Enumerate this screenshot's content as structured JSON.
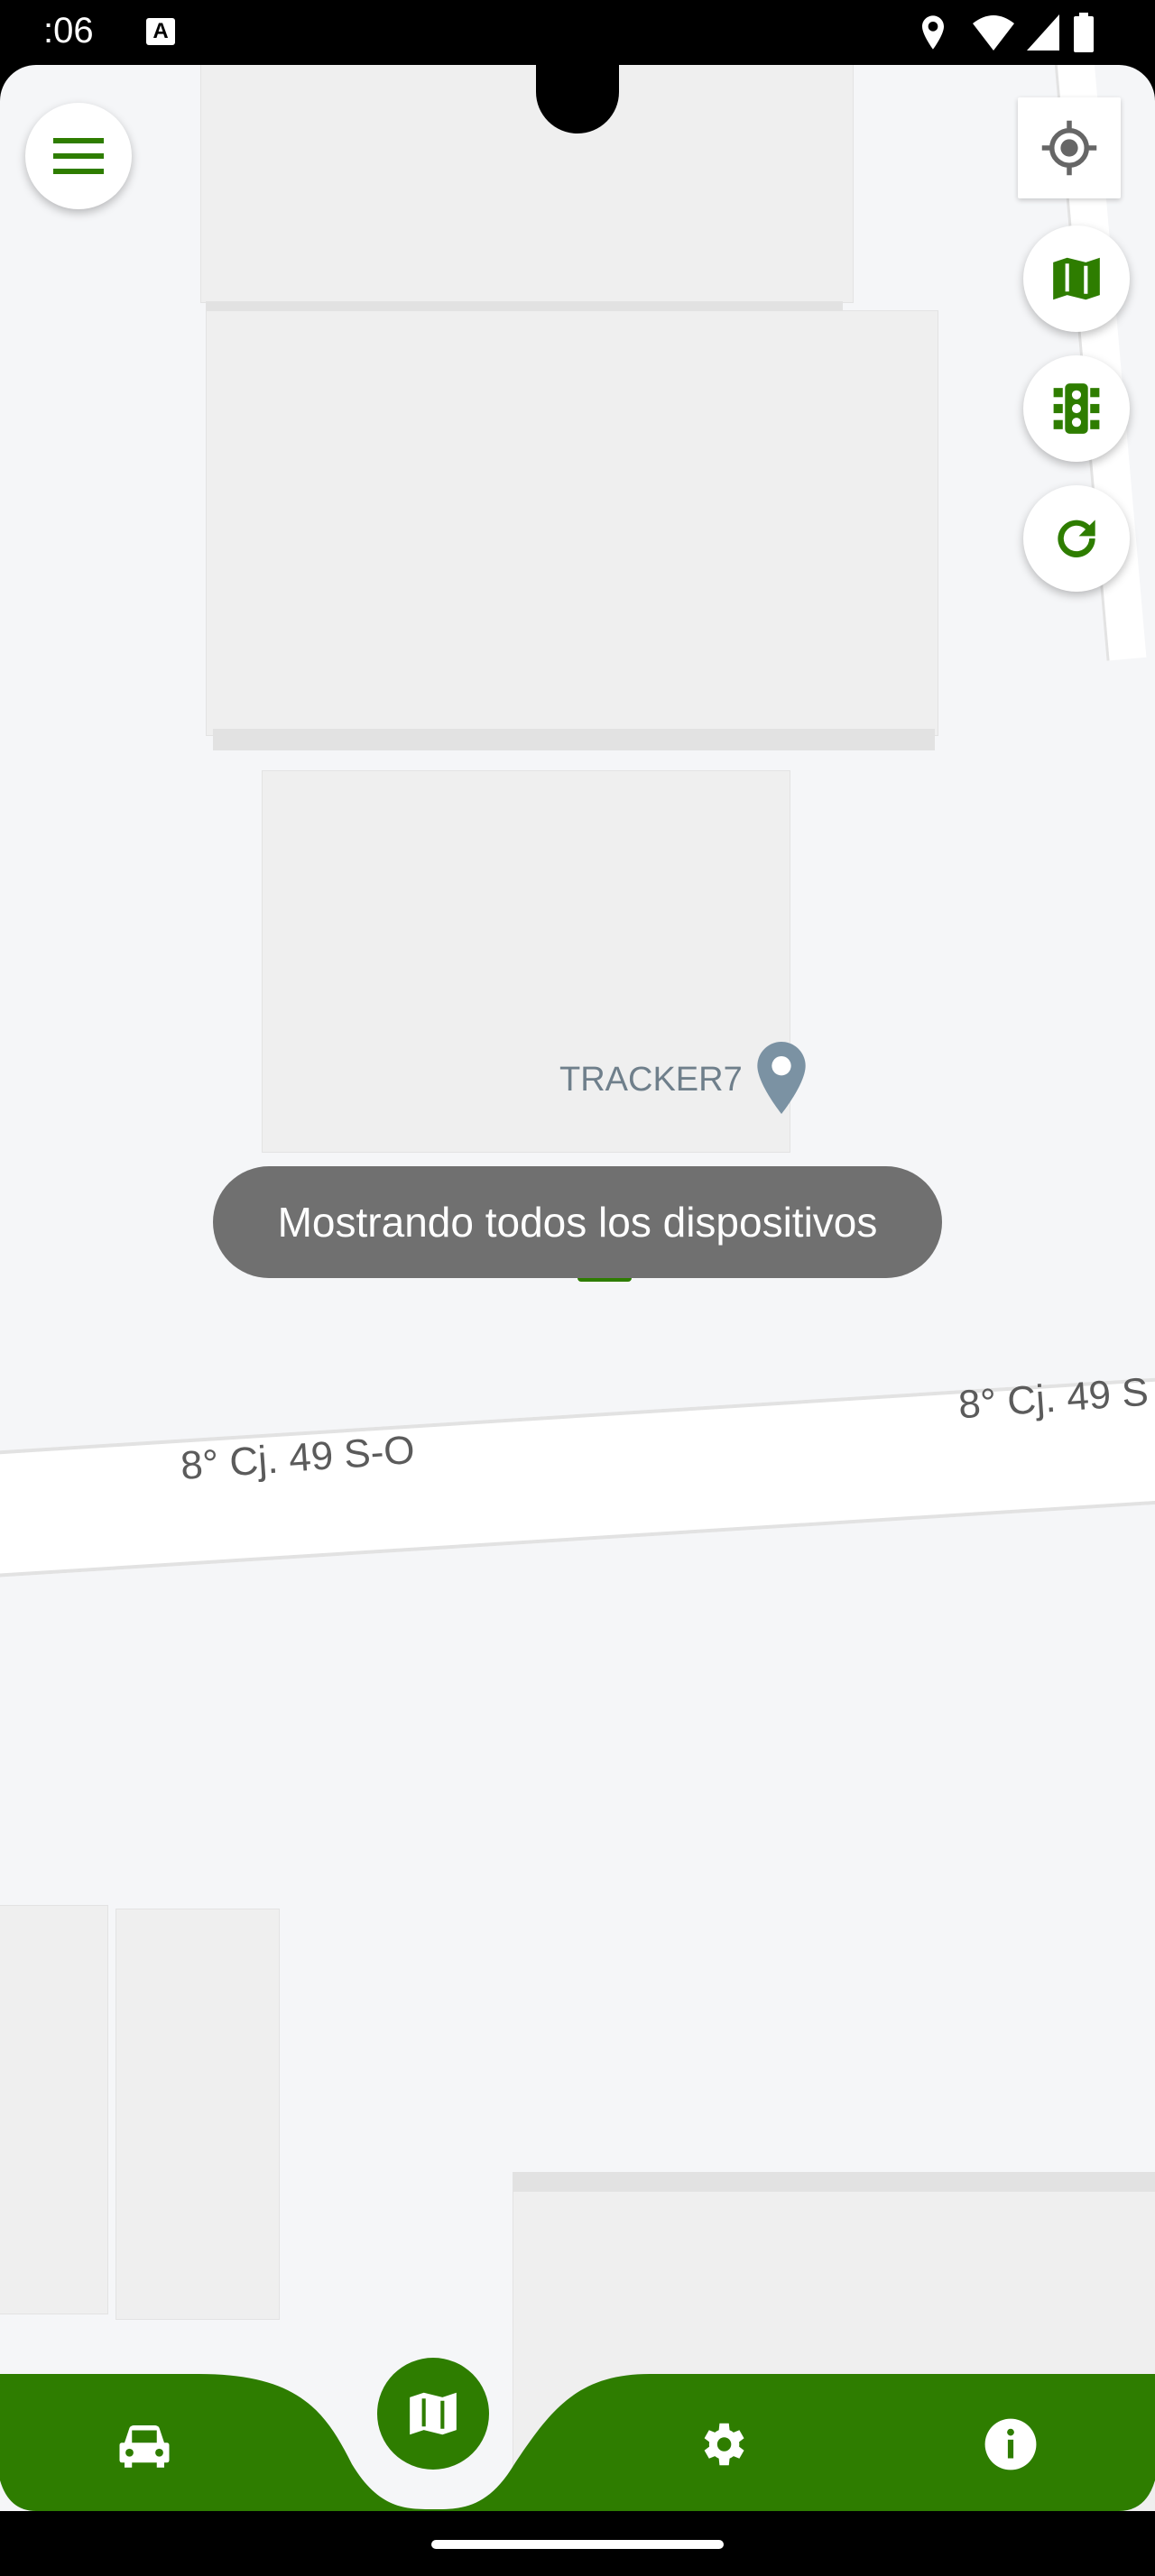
{
  "status_bar": {
    "time": ":06",
    "icons": [
      "a-keyboard-icon",
      "location-icon",
      "wifi-icon",
      "signal-icon",
      "battery-icon"
    ]
  },
  "map": {
    "poi_label": "TRACKER7",
    "road_label_left": "8° Cj. 49 S-O",
    "road_label_right": "8° Cj. 49 S",
    "icons": [
      "menu-icon",
      "my-location-icon",
      "map-type-icon",
      "traffic-icon",
      "refresh-icon",
      "place-pin-icon",
      "device-marker-icon"
    ]
  },
  "toast": {
    "message": "Mostrando todos los dispositivos"
  },
  "bottom_nav": {
    "items": [
      "car-icon",
      "map-icon",
      "settings-icon",
      "info-icon"
    ]
  },
  "colors": {
    "accent": "#2E7D00",
    "map_bg": "#F5F6F8",
    "toast_bg": "#707070"
  }
}
